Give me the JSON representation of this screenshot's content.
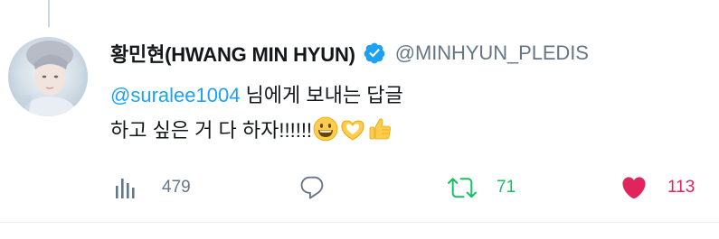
{
  "tweet": {
    "author": {
      "display_name": "황민현(HWANG MIN HYUN)",
      "handle": "@MINHYUN_PLEDIS",
      "verified": true
    },
    "reply_to": {
      "mention": "@suralee1004",
      "suffix": " 님에게 보내는 답글"
    },
    "text": "하고 싶은 거 다 하자!!!!!!",
    "emojis": [
      "grinning-face-emoji",
      "heart-hands-emoji",
      "thumbs-up-emoji"
    ]
  },
  "actions": {
    "stats_count": "479",
    "reply_count": "",
    "retweet_count": "71",
    "like_count": "113"
  },
  "colors": {
    "link": "#1da1f2",
    "muted": "#657786",
    "retweet_active": "#17bf63",
    "like_active": "#e0245e",
    "text": "#14171a"
  },
  "icons": {
    "stats": "bar-chart-icon",
    "reply": "speech-bubble-icon",
    "retweet": "retweet-arrows-icon",
    "like": "heart-icon",
    "verified": "verified-badge-icon"
  }
}
